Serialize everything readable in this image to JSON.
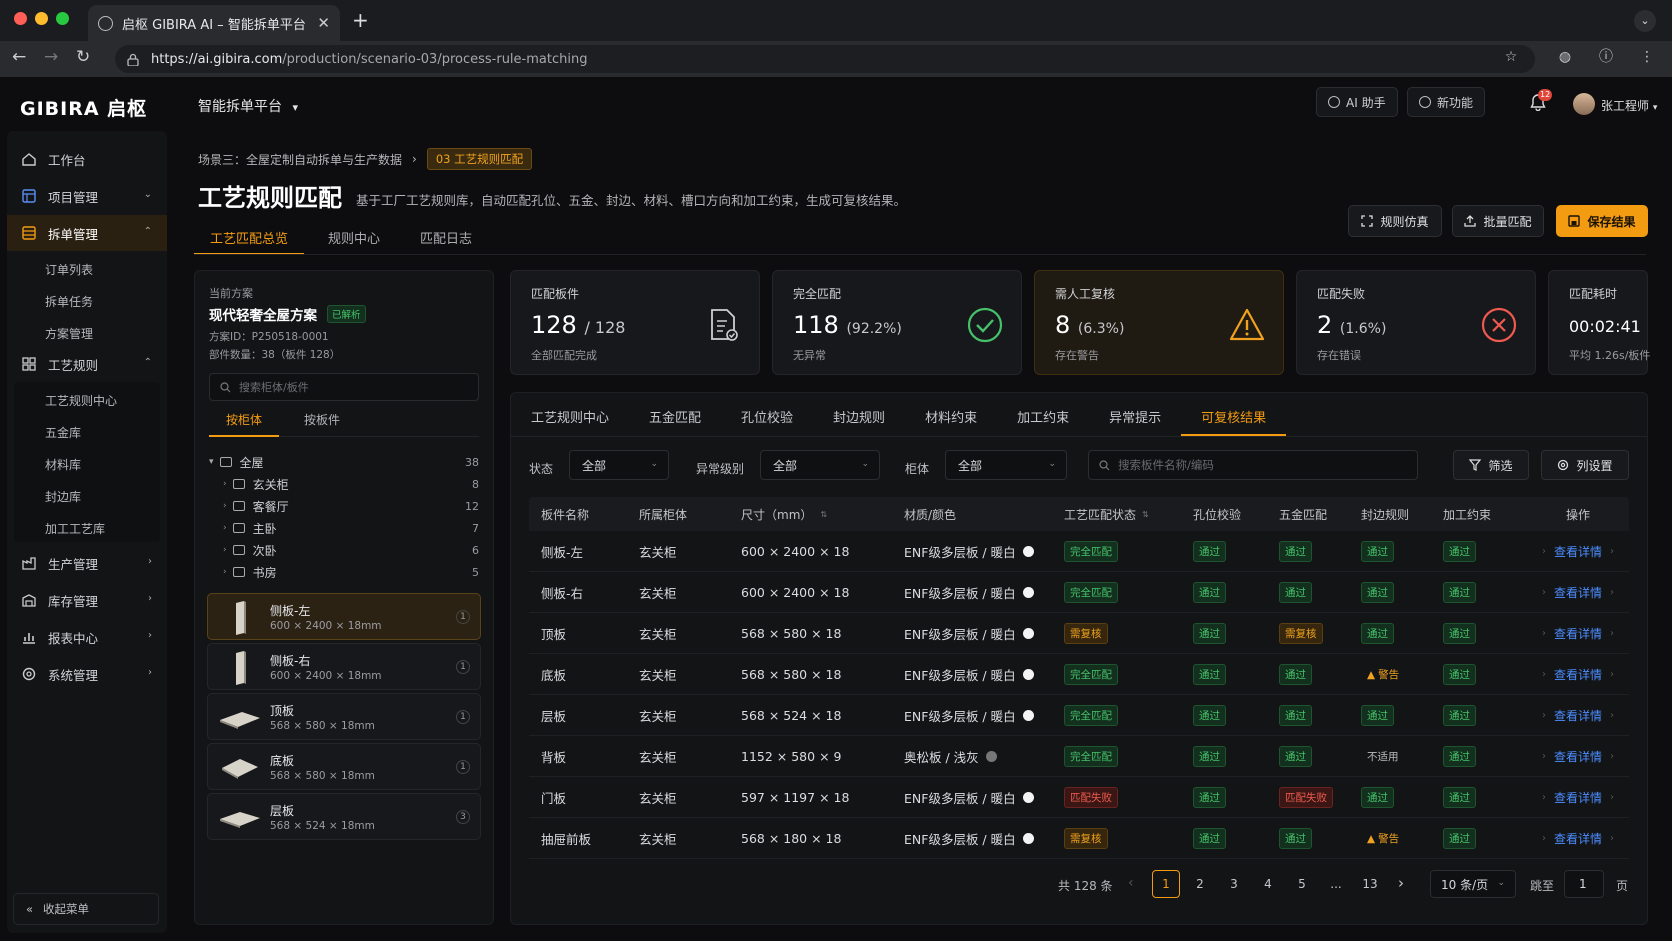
{
  "browser": {
    "tab_title": "启枢 GIBIRA AI – 智能拆单平台",
    "url": "https://ai.gibira.com/production/scenario-03/process-rule-matching",
    "url_host": "https://ai.gibira.com",
    "url_path": "/production/scenario-03/process-rule-matching"
  },
  "header": {
    "logo": "GIBIRA 启枢",
    "platform": "智能拆单平台",
    "ai_assistant": "AI 助手",
    "new_features": "新功能",
    "notifications_count": "12",
    "user_name": "张工程师"
  },
  "sidebar": {
    "items": [
      {
        "label": "工作台"
      },
      {
        "label": "项目管理"
      },
      {
        "label": "拆单管理"
      },
      {
        "label": "工艺规则"
      },
      {
        "label": "生产管理"
      },
      {
        "label": "库存管理"
      },
      {
        "label": "报表中心"
      },
      {
        "label": "系统管理"
      }
    ],
    "order_sub": [
      "订单列表",
      "拆单任务",
      "方案管理"
    ],
    "rules_sub": [
      "工艺规则中心",
      "五金库",
      "材料库",
      "封边库",
      "加工工艺库"
    ],
    "collapse": "收起菜单"
  },
  "page": {
    "breadcrumb_parent": "场景三：全屋定制自动拆单与生产数据",
    "breadcrumb_current": "03 工艺规则匹配",
    "title": "工艺规则匹配",
    "description": "基于工厂工艺规则库，自动匹配孔位、五金、封边、材料、槽口方向和加工约束，生成可复核结果。",
    "btn_simulate": "规则仿真",
    "btn_batch": "批量匹配",
    "btn_save": "保存结果",
    "tabs": [
      "工艺匹配总览",
      "规则中心",
      "匹配日志"
    ]
  },
  "scheme": {
    "label": "当前方案",
    "name": "现代轻奢全屋方案",
    "status": "已解析",
    "id": "方案ID：P250518-0001",
    "parts": "部件数量：38（板件 128）",
    "search_placeholder": "搜索柜体/板件",
    "tab_cabinet": "按柜体",
    "tab_panel": "按板件",
    "tree": [
      {
        "name": "全屋",
        "count": "38"
      },
      {
        "name": "玄关柜",
        "count": "8"
      },
      {
        "name": "客餐厅",
        "count": "12"
      },
      {
        "name": "主卧",
        "count": "7"
      },
      {
        "name": "次卧",
        "count": "6"
      },
      {
        "name": "书房",
        "count": "5"
      }
    ],
    "panels": [
      {
        "name": "侧板-左",
        "dim": "600 × 2400 × 18mm",
        "count": "1"
      },
      {
        "name": "侧板-右",
        "dim": "600 × 2400 × 18mm",
        "count": "1"
      },
      {
        "name": "顶板",
        "dim": "568 × 580 × 18mm",
        "count": "1"
      },
      {
        "name": "底板",
        "dim": "568 × 580 × 18mm",
        "count": "1"
      },
      {
        "name": "层板",
        "dim": "568 × 524 × 18mm",
        "count": "3"
      }
    ]
  },
  "stats": [
    {
      "label": "匹配板件",
      "value": "128",
      "extra": "/ 128",
      "sub": "全部匹配完成"
    },
    {
      "label": "完全匹配",
      "value": "118",
      "extra": "(92.2%)",
      "sub": "无异常"
    },
    {
      "label": "需人工复核",
      "value": "8",
      "extra": "(6.3%)",
      "sub": "存在警告"
    },
    {
      "label": "匹配失败",
      "value": "2",
      "extra": "(1.6%)",
      "sub": "存在错误"
    },
    {
      "label": "匹配耗时",
      "value": "00:02:41",
      "extra": "",
      "sub": "平均 1.26s/板件"
    }
  ],
  "colors": {
    "accent": "#f39c12",
    "ok": "#46c06a",
    "review": "#f0a21f",
    "fail": "#ee5a4f",
    "link": "#4c8dff"
  },
  "main": {
    "tabs": [
      "工艺规则中心",
      "五金匹配",
      "孔位校验",
      "封边规则",
      "材料约束",
      "加工约束",
      "异常提示",
      "可复核结果"
    ],
    "filters": {
      "status_label": "状态",
      "status_value": "全部",
      "level_label": "异常级别",
      "level_value": "全部",
      "cabinet_label": "柜体",
      "cabinet_value": "全部",
      "search_placeholder": "搜索板件名称/编码",
      "filter_btn": "筛选",
      "columns_btn": "列设置"
    },
    "columns": [
      "板件名称",
      "所属柜体",
      "尺寸（mm）",
      "材质/颜色",
      "工艺匹配状态",
      "孔位校验",
      "五金匹配",
      "封边规则",
      "加工约束",
      "操作"
    ],
    "rows": [
      {
        "name": "侧板-左",
        "cabinet": "玄关柜",
        "size": "600 × 2400 × 18",
        "material": "ENF级多层板 / 暖白",
        "swatch": "white",
        "status": "完全匹配",
        "st": "full",
        "hole": "通过",
        "hw": "通过",
        "hws": "ok",
        "edge": "通过",
        "edges": "ok",
        "proc": "通过",
        "action": "查看详情"
      },
      {
        "name": "侧板-右",
        "cabinet": "玄关柜",
        "size": "600 × 2400 × 18",
        "material": "ENF级多层板 / 暖白",
        "swatch": "white",
        "status": "完全匹配",
        "st": "full",
        "hole": "通过",
        "hw": "通过",
        "hws": "ok",
        "edge": "通过",
        "edges": "ok",
        "proc": "通过",
        "action": "查看详情"
      },
      {
        "name": "顶板",
        "cabinet": "玄关柜",
        "size": "568 × 580 × 18",
        "material": "ENF级多层板 / 暖白",
        "swatch": "white",
        "status": "需复核",
        "st": "rev",
        "hole": "通过",
        "hw": "需复核",
        "hws": "rev",
        "edge": "通过",
        "edges": "ok",
        "proc": "通过",
        "action": "查看详情"
      },
      {
        "name": "底板",
        "cabinet": "玄关柜",
        "size": "568 × 580 × 18",
        "material": "ENF级多层板 / 暖白",
        "swatch": "white",
        "status": "完全匹配",
        "st": "full",
        "hole": "通过",
        "hw": "通过",
        "hws": "ok",
        "edge": "警告",
        "edges": "warn",
        "proc": "通过",
        "action": "查看详情"
      },
      {
        "name": "层板",
        "cabinet": "玄关柜",
        "size": "568 × 524 × 18",
        "material": "ENF级多层板 / 暖白",
        "swatch": "white",
        "status": "完全匹配",
        "st": "full",
        "hole": "通过",
        "hw": "通过",
        "hws": "ok",
        "edge": "通过",
        "edges": "ok",
        "proc": "通过",
        "action": "查看详情"
      },
      {
        "name": "背板",
        "cabinet": "玄关柜",
        "size": "1152 × 580 × 9",
        "material": "奥松板 / 浅灰",
        "swatch": "gray",
        "status": "完全匹配",
        "st": "full",
        "hole": "通过",
        "hw": "通过",
        "hws": "ok",
        "edge": "不适用",
        "edges": "na",
        "proc": "通过",
        "action": "查看详情"
      },
      {
        "name": "门板",
        "cabinet": "玄关柜",
        "size": "597 × 1197 × 18",
        "material": "ENF级多层板 / 暖白",
        "swatch": "white",
        "status": "匹配失败",
        "st": "fail",
        "hole": "通过",
        "hw": "匹配失败",
        "hws": "fail",
        "edge": "通过",
        "edges": "ok",
        "proc": "通过",
        "action": "查看详情"
      },
      {
        "name": "抽屉前板",
        "cabinet": "玄关柜",
        "size": "568 × 180 × 18",
        "material": "ENF级多层板 / 暖白",
        "swatch": "white",
        "status": "需复核",
        "st": "rev",
        "hole": "通过",
        "hw": "通过",
        "hws": "ok",
        "edge": "警告",
        "edges": "warn",
        "proc": "通过",
        "action": "查看详情"
      }
    ]
  },
  "pager": {
    "total": "共 128 条",
    "pages": [
      "1",
      "2",
      "3",
      "4",
      "5",
      "...",
      "13"
    ],
    "page_size": "10 条/页",
    "goto_label": "跳至",
    "goto_value": "1",
    "goto_unit": "页"
  }
}
